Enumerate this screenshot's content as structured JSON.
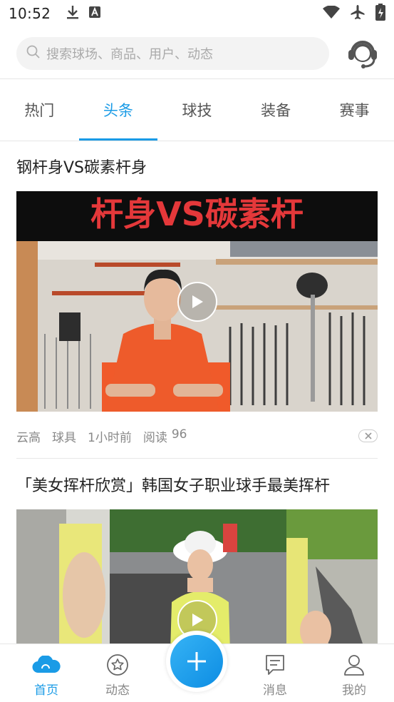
{
  "status_bar": {
    "time": "10:52",
    "left_icons": [
      "download-icon",
      "font-a-icon"
    ],
    "right_icons": [
      "wifi-icon",
      "airplane-icon",
      "battery-icon"
    ]
  },
  "search": {
    "placeholder": "搜索球场、商品、用户、动态"
  },
  "tabs": [
    {
      "label": "热门",
      "active": false
    },
    {
      "label": "头条",
      "active": true
    },
    {
      "label": "球技",
      "active": false
    },
    {
      "label": "装备",
      "active": false
    },
    {
      "label": "赛事",
      "active": false
    }
  ],
  "articles": [
    {
      "title": "钢杆身VS碳素杆身",
      "banner_text": "杆身VS碳素杆",
      "meta": {
        "author": "云高",
        "category": "球具",
        "time": "1小时前",
        "views_label": "阅读",
        "views": "96"
      }
    },
    {
      "title": "「美女挥杆欣赏」韩国女子职业球手最美挥杆",
      "meta": {}
    }
  ],
  "bottom_nav": [
    {
      "label": "首页",
      "icon": "cloud-home-icon",
      "active": true
    },
    {
      "label": "动态",
      "icon": "star-circle-icon",
      "active": false
    },
    {
      "label": "消息",
      "icon": "message-icon",
      "active": false
    },
    {
      "label": "我的",
      "icon": "user-icon",
      "active": false
    }
  ],
  "colors": {
    "accent": "#1a9be6",
    "text_primary": "#222222",
    "text_secondary": "#888888"
  }
}
